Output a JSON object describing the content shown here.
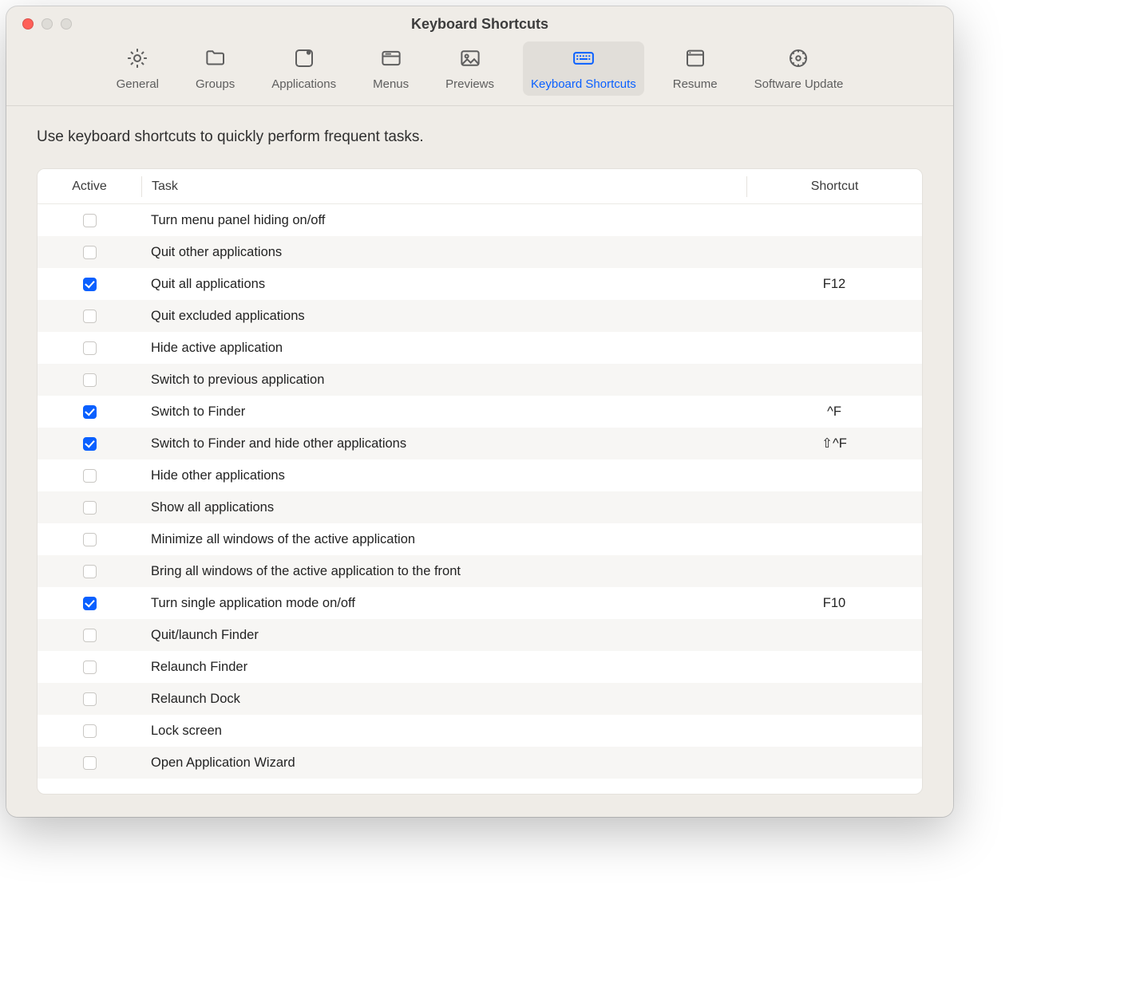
{
  "window": {
    "title": "Keyboard Shortcuts"
  },
  "toolbar": {
    "items": [
      {
        "id": "general",
        "label": "General"
      },
      {
        "id": "groups",
        "label": "Groups"
      },
      {
        "id": "apps",
        "label": "Applications"
      },
      {
        "id": "menus",
        "label": "Menus"
      },
      {
        "id": "previews",
        "label": "Previews"
      },
      {
        "id": "keyboard",
        "label": "Keyboard Shortcuts",
        "selected": true
      },
      {
        "id": "resume",
        "label": "Resume"
      },
      {
        "id": "update",
        "label": "Software Update"
      }
    ]
  },
  "intro": "Use keyboard shortcuts to quickly perform frequent tasks.",
  "columns": {
    "active": "Active",
    "task": "Task",
    "shortcut": "Shortcut"
  },
  "rows": [
    {
      "active": false,
      "task": "Turn menu panel hiding on/off",
      "shortcut": ""
    },
    {
      "active": false,
      "task": "Quit other applications",
      "shortcut": ""
    },
    {
      "active": true,
      "task": "Quit all applications",
      "shortcut": "F12"
    },
    {
      "active": false,
      "task": "Quit excluded applications",
      "shortcut": ""
    },
    {
      "active": false,
      "task": "Hide active application",
      "shortcut": ""
    },
    {
      "active": false,
      "task": "Switch to previous application",
      "shortcut": ""
    },
    {
      "active": true,
      "task": "Switch to Finder",
      "shortcut": "^F"
    },
    {
      "active": true,
      "task": "Switch to Finder and hide other applications",
      "shortcut": "⇧^F"
    },
    {
      "active": false,
      "task": "Hide other applications",
      "shortcut": ""
    },
    {
      "active": false,
      "task": "Show all applications",
      "shortcut": ""
    },
    {
      "active": false,
      "task": "Minimize all windows of the active application",
      "shortcut": ""
    },
    {
      "active": false,
      "task": "Bring all windows of the active application to the front",
      "shortcut": ""
    },
    {
      "active": true,
      "task": "Turn single application mode on/off",
      "shortcut": "F10"
    },
    {
      "active": false,
      "task": "Quit/launch Finder",
      "shortcut": ""
    },
    {
      "active": false,
      "task": "Relaunch Finder",
      "shortcut": ""
    },
    {
      "active": false,
      "task": "Relaunch Dock",
      "shortcut": ""
    },
    {
      "active": false,
      "task": "Lock screen",
      "shortcut": ""
    },
    {
      "active": false,
      "task": "Open Application Wizard",
      "shortcut": ""
    }
  ]
}
